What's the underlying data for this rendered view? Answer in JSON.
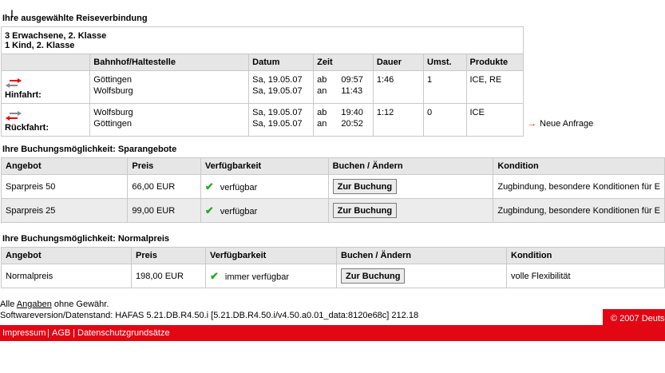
{
  "connection": {
    "title": "Ihre ausgewählte Reiseverbindung",
    "passengers": [
      "3 Erwachsene, 2. Klasse",
      "1 Kind, 2. Klasse"
    ],
    "headers": [
      "Bahnhof/Haltestelle",
      "Datum",
      "Zeit",
      "Dauer",
      "Umst.",
      "Produkte"
    ],
    "trips": [
      {
        "label": "Hinfahrt:",
        "from": "Göttingen",
        "to": "Wolfsburg",
        "date_from": "Sa, 19.05.07",
        "date_to": "Sa, 19.05.07",
        "dep": "ab",
        "arr": "an",
        "time_dep": "09:57",
        "time_arr": "11:43",
        "duration": "1:46",
        "changes": "1",
        "products": "ICE, RE"
      },
      {
        "label": "Rückfahrt:",
        "from": "Wolfsburg",
        "to": "Göttingen",
        "date_from": "Sa, 19.05.07",
        "date_to": "Sa, 19.05.07",
        "dep": "ab",
        "arr": "an",
        "time_dep": "19:40",
        "time_arr": "20:52",
        "duration": "1:12",
        "changes": "0",
        "products": "ICE"
      }
    ],
    "new_request": "Neue Anfrage"
  },
  "saver": {
    "title": "Ihre Buchungsmöglichkeit: Sparangebote",
    "headers": [
      "Angebot",
      "Preis",
      "Verfügbarkeit",
      "Buchen / Ändern",
      "Kondition"
    ],
    "rows": [
      {
        "offer": "Sparpreis 50",
        "price": "66,00 EUR",
        "availability": "verfügbar",
        "button": "Zur Buchung",
        "condition": "Zugbindung, besondere Konditionen für E"
      },
      {
        "offer": "Sparpreis 25",
        "price": "99,00 EUR",
        "availability": "verfügbar",
        "button": "Zur Buchung",
        "condition": "Zugbindung, besondere Konditionen für E"
      }
    ]
  },
  "normal": {
    "title": "Ihre Buchungsmöglichkeit: Normalpreis",
    "headers": [
      "Angebot",
      "Preis",
      "Verfügbarkeit",
      "Buchen / Ändern",
      "Kondition"
    ],
    "rows": [
      {
        "offer": "Normalpreis",
        "price": "198,00 EUR",
        "availability": "immer verfügbar",
        "button": "Zur Buchung",
        "condition": "volle Flexibilität"
      }
    ]
  },
  "footer": {
    "disclaimer_pre": "Alle ",
    "disclaimer_link": "Angaben",
    "disclaimer_post": " ohne Gewähr.",
    "software": "Softwareversion/Datenstand: HAFAS 5.21.DB.R4.50.i [5.21.DB.R4.50.i/v4.50.a0.01_data:8120e68c] 212.18",
    "copyright": "© 2007 Deutsc",
    "links": [
      "Impressum",
      "AGB",
      "Datenschutzgrundsätze"
    ],
    "separator": "|"
  },
  "colors": {
    "brand_red": "#e30613",
    "check_green": "#22aa22",
    "header_grey": "#e6e6e6"
  },
  "icons": {
    "trip_arrows": "two-way-arrows-icon",
    "new_request": "red-arrow-right-icon",
    "check": "green-check-icon"
  }
}
